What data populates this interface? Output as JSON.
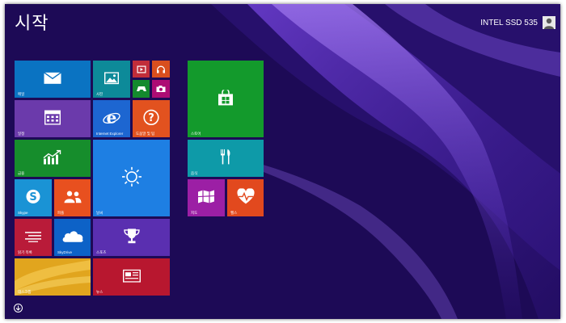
{
  "screen": {
    "title": "시작",
    "background": "#1d0a56",
    "user": {
      "name": "INTEL SSD 535",
      "avatar_icon": "user-avatar-icon"
    }
  },
  "tiles": [
    {
      "id": "mail",
      "label": "메일",
      "color": "#0a73c2",
      "icon": "mail-icon"
    },
    {
      "id": "photos",
      "label": "사진",
      "color": "#0d8a99",
      "icon": "photo-icon"
    },
    {
      "id": "video",
      "label": "",
      "color": "#c12d3a",
      "icon": "video-icon"
    },
    {
      "id": "music",
      "label": "",
      "color": "#d84f1e",
      "icon": "headphones-icon"
    },
    {
      "id": "games",
      "label": "",
      "color": "#148a2e",
      "icon": "gamepad-icon"
    },
    {
      "id": "camera",
      "label": "",
      "color": "#ad0c74",
      "icon": "camera-icon"
    },
    {
      "id": "calendar",
      "label": "일정",
      "color": "#6b3aab",
      "icon": "calendar-icon"
    },
    {
      "id": "ie",
      "label": "Internet Explorer",
      "color": "#1d66d1",
      "icon": "ie-icon"
    },
    {
      "id": "help",
      "label": "도움말 및 팁",
      "color": "#e2521f",
      "icon": "help-icon"
    },
    {
      "id": "finance",
      "label": "금융",
      "color": "#168d2c",
      "icon": "finance-icon"
    },
    {
      "id": "weather",
      "label": "날씨",
      "color": "#1e7fe3",
      "icon": "sun-icon"
    },
    {
      "id": "skype",
      "label": "Skype",
      "color": "#1a93d5",
      "icon": "skype-icon"
    },
    {
      "id": "people",
      "label": "피플",
      "color": "#e8501f",
      "icon": "people-icon"
    },
    {
      "id": "reading",
      "label": "읽기 목록",
      "color": "#b91b39",
      "icon": "reading-list-icon"
    },
    {
      "id": "skydrive",
      "label": "SkyDrive",
      "color": "#0d62c7",
      "icon": "cloud-icon"
    },
    {
      "id": "sports",
      "label": "스포츠",
      "color": "#5a2fb0",
      "icon": "trophy-icon"
    },
    {
      "id": "desktop",
      "label": "데스크톱",
      "color": "#d9a21a",
      "icon": ""
    },
    {
      "id": "news",
      "label": "뉴스",
      "color": "#b8172f",
      "icon": "news-icon"
    },
    {
      "id": "store",
      "label": "스토어",
      "color": "#139a2c",
      "icon": "store-icon"
    },
    {
      "id": "food",
      "label": "음식",
      "color": "#0e9aa8",
      "icon": "food-icon"
    },
    {
      "id": "maps",
      "label": "지도",
      "color": "#9c1fa5",
      "icon": "map-icon"
    },
    {
      "id": "health",
      "label": "헬스",
      "color": "#e2491e",
      "icon": "heart-pulse-icon"
    }
  ],
  "apps_button": {
    "icon": "down-arrow-icon"
  }
}
